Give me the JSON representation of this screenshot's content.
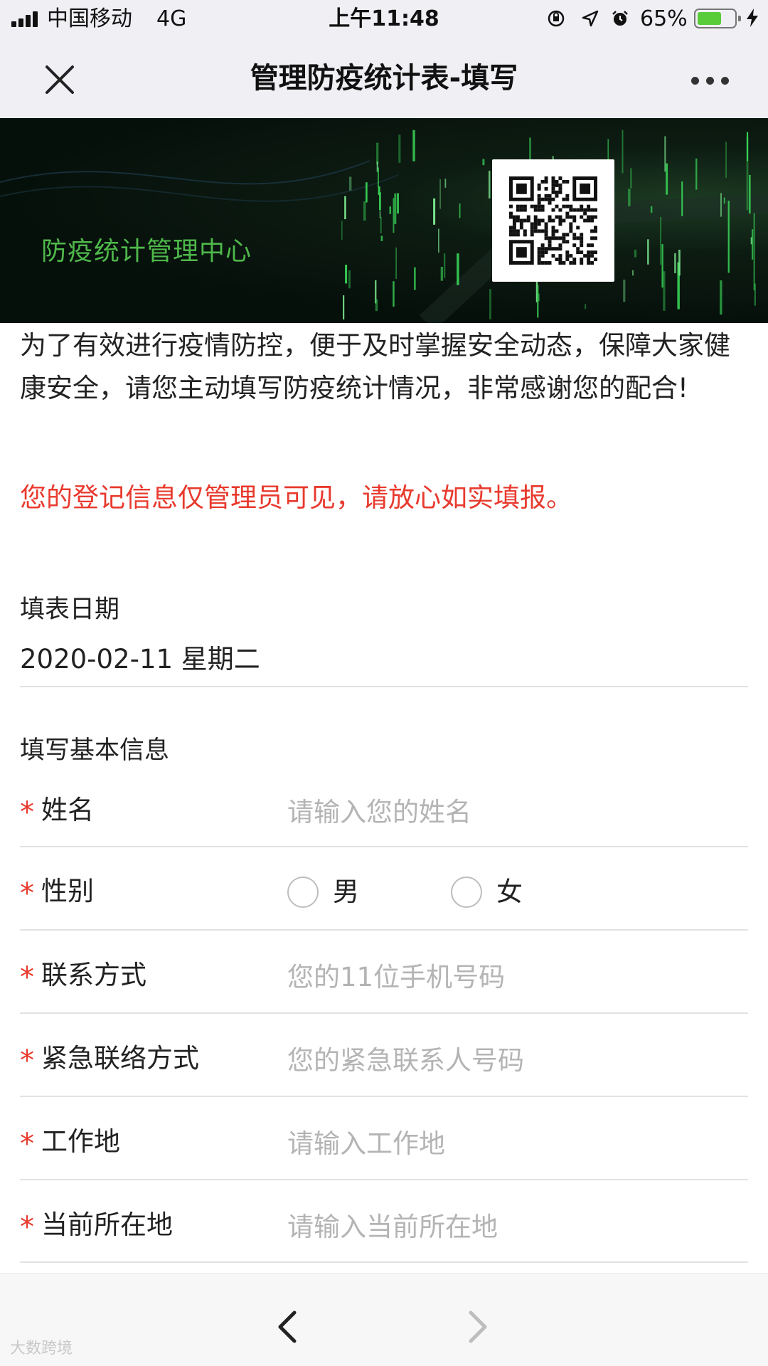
{
  "status_bar": {
    "carrier": "中国移动",
    "network": "4G",
    "time": "上午11:48",
    "battery_percent": "65%",
    "battery_level": 0.65,
    "icons": [
      "signal-icon",
      "orientation-lock-icon",
      "location-icon",
      "alarm-icon",
      "battery-icon",
      "charging-icon"
    ]
  },
  "nav": {
    "title": "管理防疫统计表-填写",
    "close_icon": "close-icon",
    "more_icon": "more-icon"
  },
  "banner": {
    "title": "防疫统计管理中心",
    "qr_icon": "qr-code"
  },
  "intro": {
    "text": "为了有效进行疫情防控，便于及时掌握安全动态，保障大家健康安全，请您主动填写防疫统计情况，非常感谢您的配合!",
    "notice": "您的登记信息仅管理员可见，请放心如实填报。"
  },
  "date": {
    "label": "填表日期",
    "value": "2020-02-11 星期二"
  },
  "basic_info": {
    "section_label": "填写基本信息",
    "required_mark": "*",
    "fields": {
      "name": {
        "label": "姓名",
        "placeholder": "请输入您的姓名"
      },
      "gender": {
        "label": "性别",
        "options": [
          "男",
          "女"
        ]
      },
      "phone": {
        "label": "联系方式",
        "placeholder": "您的11位手机号码"
      },
      "emergency": {
        "label": "紧急联络方式",
        "placeholder": "您的紧急联系人号码"
      },
      "workplace": {
        "label": "工作地",
        "placeholder": "请输入工作地"
      },
      "current_location": {
        "label": "当前所在地",
        "placeholder": "请输入当前所在地"
      }
    }
  },
  "bottom_bar": {
    "back_icon": "chevron-left-icon",
    "forward_icon": "chevron-right-icon",
    "watermark": "大数跨境"
  },
  "colors": {
    "required": "#e83a2e",
    "banner_title": "#4fb84a",
    "placeholder": "#b4b4b4",
    "bar_bg": "#efeff4"
  }
}
